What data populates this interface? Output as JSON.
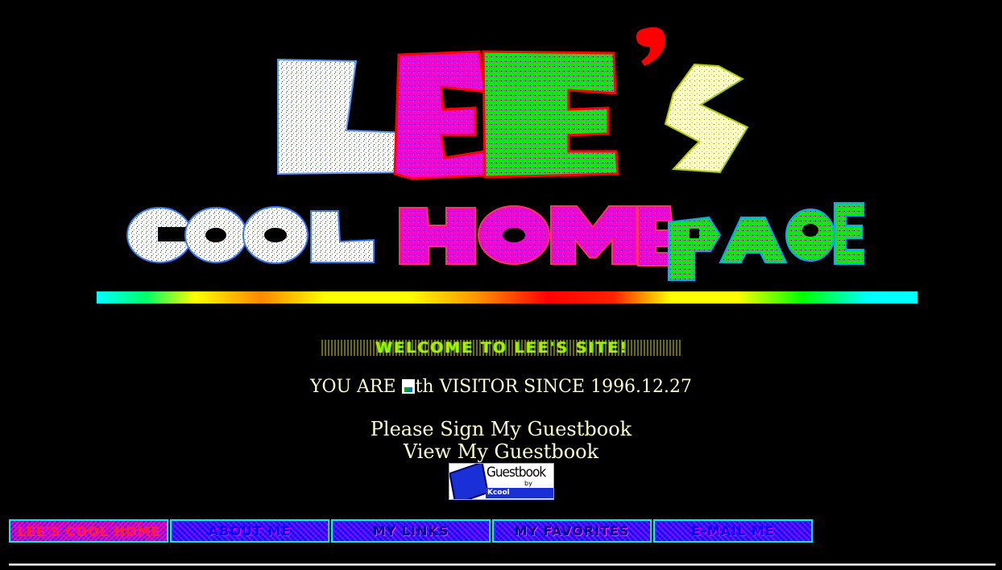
{
  "logo": {
    "line1": [
      "L",
      "E",
      "E",
      "'",
      "S"
    ],
    "line2_cool": "COOL",
    "line2_home": "HOME",
    "line2_page": "PAGE",
    "colors": {
      "white_fill": "#ffffff",
      "dot_blue": "#0055ff",
      "magenta": "#ff00cc",
      "green": "#00ee00",
      "red": "#ff0000",
      "yellow_white": "#ffffcc"
    }
  },
  "welcome": {
    "text": "WELCOME TO LEE'S SITE!"
  },
  "visitor": {
    "prefix": "YOU ARE ",
    "suffix": "th VISITOR SINCE 1996.12.27"
  },
  "guestbook": {
    "sign_label": "Please Sign My Guestbook",
    "view_label": "View My Guestbook",
    "badge_title": "Guestbook",
    "badge_sub": "by",
    "badge_brand": "Kcool"
  },
  "nav": [
    {
      "label": "LEE'S COOL HOME"
    },
    {
      "label": "ABOUT ME"
    },
    {
      "label": "MY LINKS"
    },
    {
      "label": "MY FAVORITES"
    },
    {
      "label": "E-MAIL ME"
    }
  ]
}
